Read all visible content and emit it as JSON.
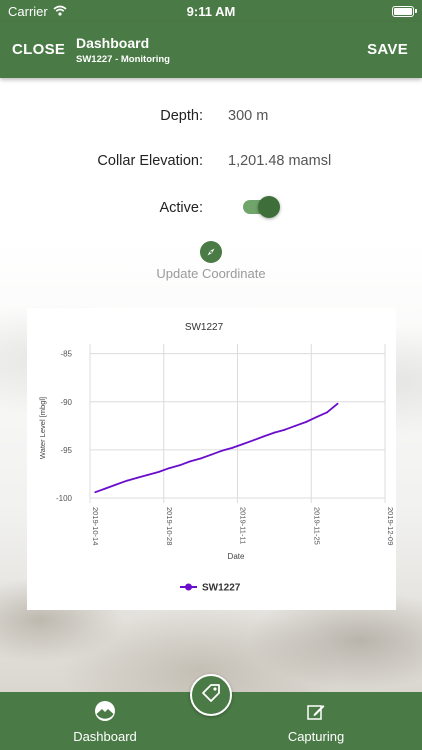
{
  "status_bar": {
    "carrier": "Carrier",
    "time": "9:11 AM"
  },
  "nav": {
    "close_label": "CLOSE",
    "title": "Dashboard",
    "subtitle": "SW1227 - Monitoring",
    "save_label": "SAVE"
  },
  "fields": {
    "depth": {
      "label": "Depth:",
      "value": "300 m"
    },
    "collar": {
      "label": "Collar Elevation:",
      "value": "1,201.48 mamsl"
    },
    "active": {
      "label": "Active:",
      "value": true
    }
  },
  "update_coordinate_label": "Update Coordinate",
  "chart_data": {
    "type": "line",
    "title": "SW1227",
    "xlabel": "Date",
    "ylabel": "Water Level [mbgl]",
    "x_tick_labels": [
      "2019-10-14",
      "2019-10-28",
      "2019-11-11",
      "2019-11-25",
      "2019-12-09"
    ],
    "y_tick_labels": [
      "-85",
      "-90",
      "-95",
      "-100"
    ],
    "ylim": [
      -100,
      -84
    ],
    "xlim": [
      "2019-10-14",
      "2019-12-09"
    ],
    "grid": true,
    "legend_position": "bottom",
    "series": [
      {
        "name": "SW1227",
        "color": "#6a0dcc",
        "x": [
          "2019-10-15",
          "2019-10-17",
          "2019-10-19",
          "2019-10-21",
          "2019-10-23",
          "2019-10-25",
          "2019-10-27",
          "2019-10-29",
          "2019-10-31",
          "2019-11-02",
          "2019-11-04",
          "2019-11-06",
          "2019-11-08",
          "2019-11-10",
          "2019-11-12",
          "2019-11-14",
          "2019-11-16",
          "2019-11-18",
          "2019-11-20",
          "2019-11-22",
          "2019-11-24",
          "2019-11-26",
          "2019-11-28",
          "2019-11-30"
        ],
        "y": [
          -99.4,
          -99.0,
          -98.6,
          -98.2,
          -97.9,
          -97.6,
          -97.3,
          -96.9,
          -96.6,
          -96.2,
          -95.9,
          -95.5,
          -95.1,
          -94.8,
          -94.4,
          -94.0,
          -93.6,
          -93.2,
          -92.9,
          -92.5,
          -92.1,
          -91.6,
          -91.1,
          -90.2
        ]
      }
    ]
  },
  "tabs": {
    "dashboard_label": "Dashboard",
    "capturing_label": "Capturing"
  },
  "colors": {
    "primary": "#4a7a45",
    "toggle_track": "#6fa56a",
    "series": "#6a0dcc"
  },
  "icons": [
    "wifi-icon",
    "battery-icon",
    "compass-icon",
    "tag-icon",
    "landscape-icon",
    "edit-icon"
  ]
}
